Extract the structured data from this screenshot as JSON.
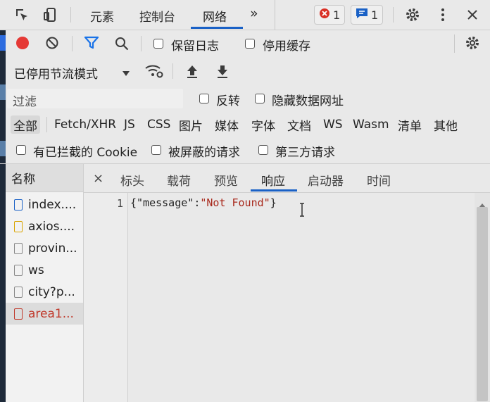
{
  "topbar": {
    "tabs": [
      "元素",
      "控制台",
      "网络"
    ],
    "more": "»",
    "error_count": "1",
    "message_count": "1"
  },
  "toolbar1": {
    "preserve_log": "保留日志",
    "disable_cache": "停用缓存"
  },
  "toolbar2": {
    "throttle": "已停用节流模式"
  },
  "toolbar3": {
    "filter_placeholder": "过滤",
    "invert": "反转",
    "hide_data_urls": "隐藏数据网址"
  },
  "filterbar": {
    "types": [
      "全部",
      "Fetch/XHR",
      "JS",
      "CSS",
      "图片",
      "媒体",
      "字体",
      "文档",
      "WS",
      "Wasm",
      "清单",
      "其他"
    ]
  },
  "toolbar4": {
    "blocked_cookies": "有已拦截的 Cookie",
    "blocked_requests": "被屏蔽的请求",
    "third_party": "第三方请求"
  },
  "requests": {
    "header": "名称",
    "items": [
      "index....",
      "axios....",
      "provin...",
      "ws",
      "city?p...",
      "area1..."
    ]
  },
  "detail": {
    "close": "×",
    "tabs": [
      "标头",
      "载荷",
      "预览",
      "响应",
      "启动器",
      "时间"
    ],
    "line_number": "1",
    "response_open": "{",
    "response_key": "\"message\"",
    "response_colon": ":",
    "response_value": "\"Not Found\"",
    "response_close": "}"
  },
  "colors": {
    "accent": "#1a61c6",
    "record": "#e53935",
    "filter_active": "#1a73e8",
    "error_badge": "#d93025",
    "selected_request": "#c0392b"
  }
}
